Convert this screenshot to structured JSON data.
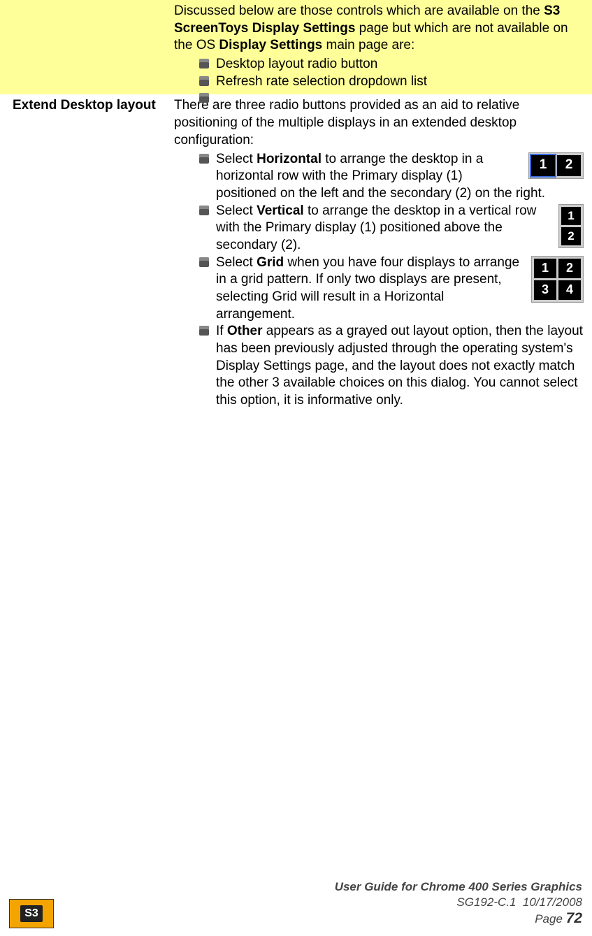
{
  "notice": {
    "intro_a": "Discussed below are those controls which are available on the ",
    "bold_a": "S3 ScreenToys Display Settings",
    "intro_b": " page but which are not available on the OS ",
    "bold_b": "Display Settings",
    "intro_c": " main page are:",
    "items": [
      "Desktop layout radio button",
      "Refresh rate selection dropdown list"
    ]
  },
  "section": {
    "heading": "Extend Desktop layout",
    "intro": "There are three radio buttons provided as an aid to relative positioning of the multiple displays in an extended desktop configuration:",
    "items": {
      "h_a": "Select ",
      "h_b": "Horizontal",
      "h_c": " to arrange the desktop in a horizontal row with the Primary display (1) positioned on the left and the secondary (2) on the right.",
      "v_a": "Select ",
      "v_b": "Vertical",
      "v_c": " to arrange the desktop in a vertical row with the Primary display (1) positioned above the secondary (2).",
      "g_a": "Select ",
      "g_b": "Grid",
      "g_c": " when you have four displays to arrange in a grid pattern. If only two displays are present, selecting Grid will result in a Horizontal arrangement.",
      "o_a": "If ",
      "o_b": "Other",
      "o_c": " appears as a grayed out layout option, then the layout has been previously adjusted through the operating system's Display Settings page, and the layout does not exactly match the other 3 available choices on this dialog. You cannot select this option, it is informative only."
    }
  },
  "monitors": {
    "1": "1",
    "2": "2",
    "3": "3",
    "4": "4"
  },
  "footer": {
    "logo": "S3",
    "title": "User Guide for Chrome 400 Series Graphics",
    "docid": "SG192-C.1",
    "date": "10/17/2008",
    "page_label": "Page ",
    "page_num": "72"
  }
}
